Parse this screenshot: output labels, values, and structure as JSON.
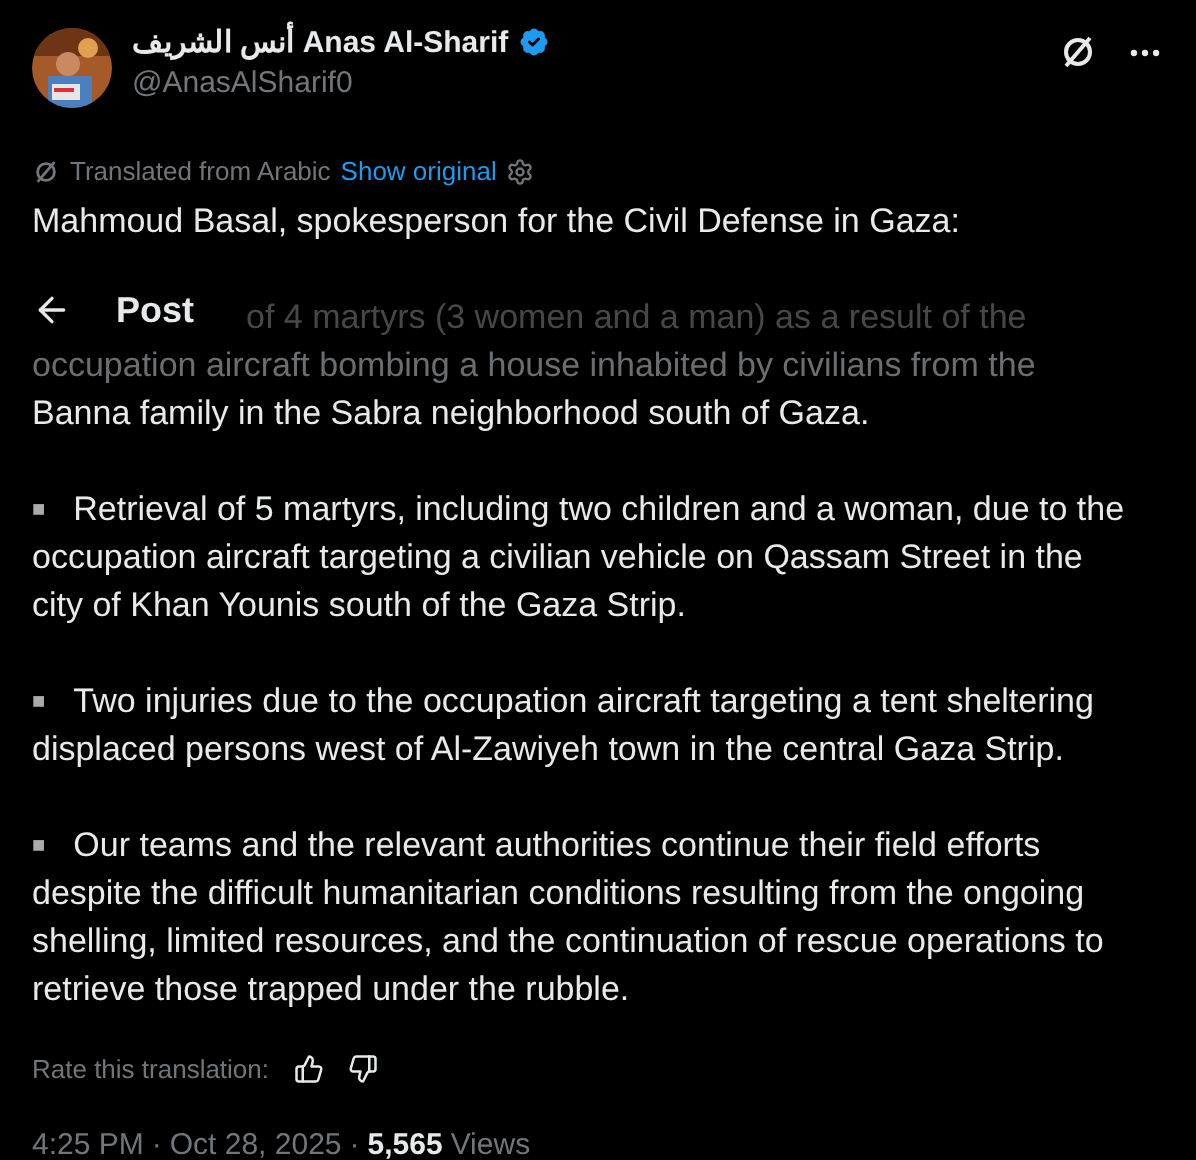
{
  "author": {
    "name_arabic": "أنس الشريف",
    "name": "Anas Al-Sharif",
    "verified": true,
    "handle": "@AnasAlSharif0"
  },
  "header": {
    "title": "Post"
  },
  "translation": {
    "label": "Translated from Arabic",
    "link": "Show original"
  },
  "intro": "Mahmoud Basal, spokesperson for the Civil Defense in Gaza:",
  "covered_paragraph": {
    "lines": [
      {
        "text": "of 4 martyrs (3 women and a man) as a result of the",
        "dim": true
      },
      {
        "text": "occupation aircraft bombing a house inhabited by civilians from the",
        "dim": true
      },
      {
        "text": "Banna family in the Sabra neighborhood south of Gaza.",
        "dim": false
      }
    ]
  },
  "paragraphs": [
    {
      "bullet": "■",
      "text": "Retrieval of 5 martyrs, including two children and a woman, due to the occupation aircraft targeting a civilian vehicle on Qassam Street in the city of Khan Younis south of the Gaza Strip."
    },
    {
      "bullet": "■",
      "text": "Two injuries due to the occupation aircraft targeting a tent sheltering displaced persons west of Al-Zawiyeh town in the central Gaza Strip."
    },
    {
      "bullet": "■",
      "text": "Our teams and the relevant authorities continue their field efforts despite the difficult humanitarian conditions resulting from the ongoing shelling, limited resources, and the continuation of rescue operations to retrieve those trapped under the rubble."
    }
  ],
  "rate": {
    "label": "Rate this translation:"
  },
  "meta": {
    "time": "4:25 PM",
    "separator": "·",
    "date": "Oct 28, 2025",
    "separator_2": "·",
    "views_count": "5,565",
    "views_label": "Views"
  }
}
